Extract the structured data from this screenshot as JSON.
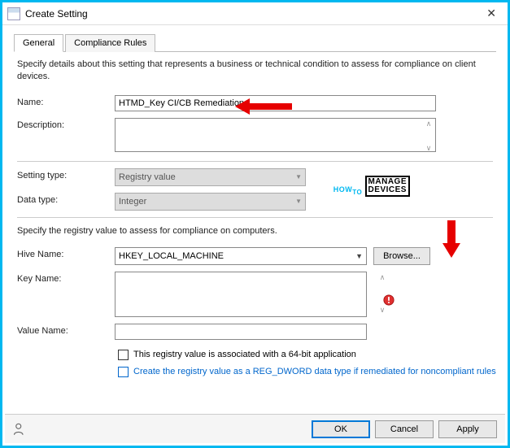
{
  "window": {
    "title": "Create Setting"
  },
  "tabs": {
    "general": "General",
    "compliance": "Compliance Rules"
  },
  "intro": "Specify details about this setting that represents a business or technical condition to assess for compliance on client devices.",
  "labels": {
    "name": "Name:",
    "description": "Description:",
    "setting_type": "Setting type:",
    "data_type": "Data type:",
    "hive_name": "Hive Name:",
    "key_name": "Key Name:",
    "value_name": "Value Name:"
  },
  "fields": {
    "name_value": "HTMD_Key CI/CB Remediation",
    "description_value": "",
    "setting_type": "Registry value",
    "data_type": "Integer",
    "hive_name": "HKEY_LOCAL_MACHINE",
    "key_name": "",
    "value_name": ""
  },
  "section_text": "Specify the registry value to assess for compliance on computers.",
  "buttons": {
    "browse": "Browse...",
    "ok": "OK",
    "cancel": "Cancel",
    "apply": "Apply"
  },
  "checkboxes": {
    "cb64": "This registry value is associated with a 64-bit application",
    "cbcreate": "Create the registry value as a REG_DWORD data type if remediated for noncompliant rules"
  },
  "watermark": {
    "how": "HOW",
    "to": "TO",
    "manage": "MANAGE",
    "devices": "DEVICES"
  }
}
